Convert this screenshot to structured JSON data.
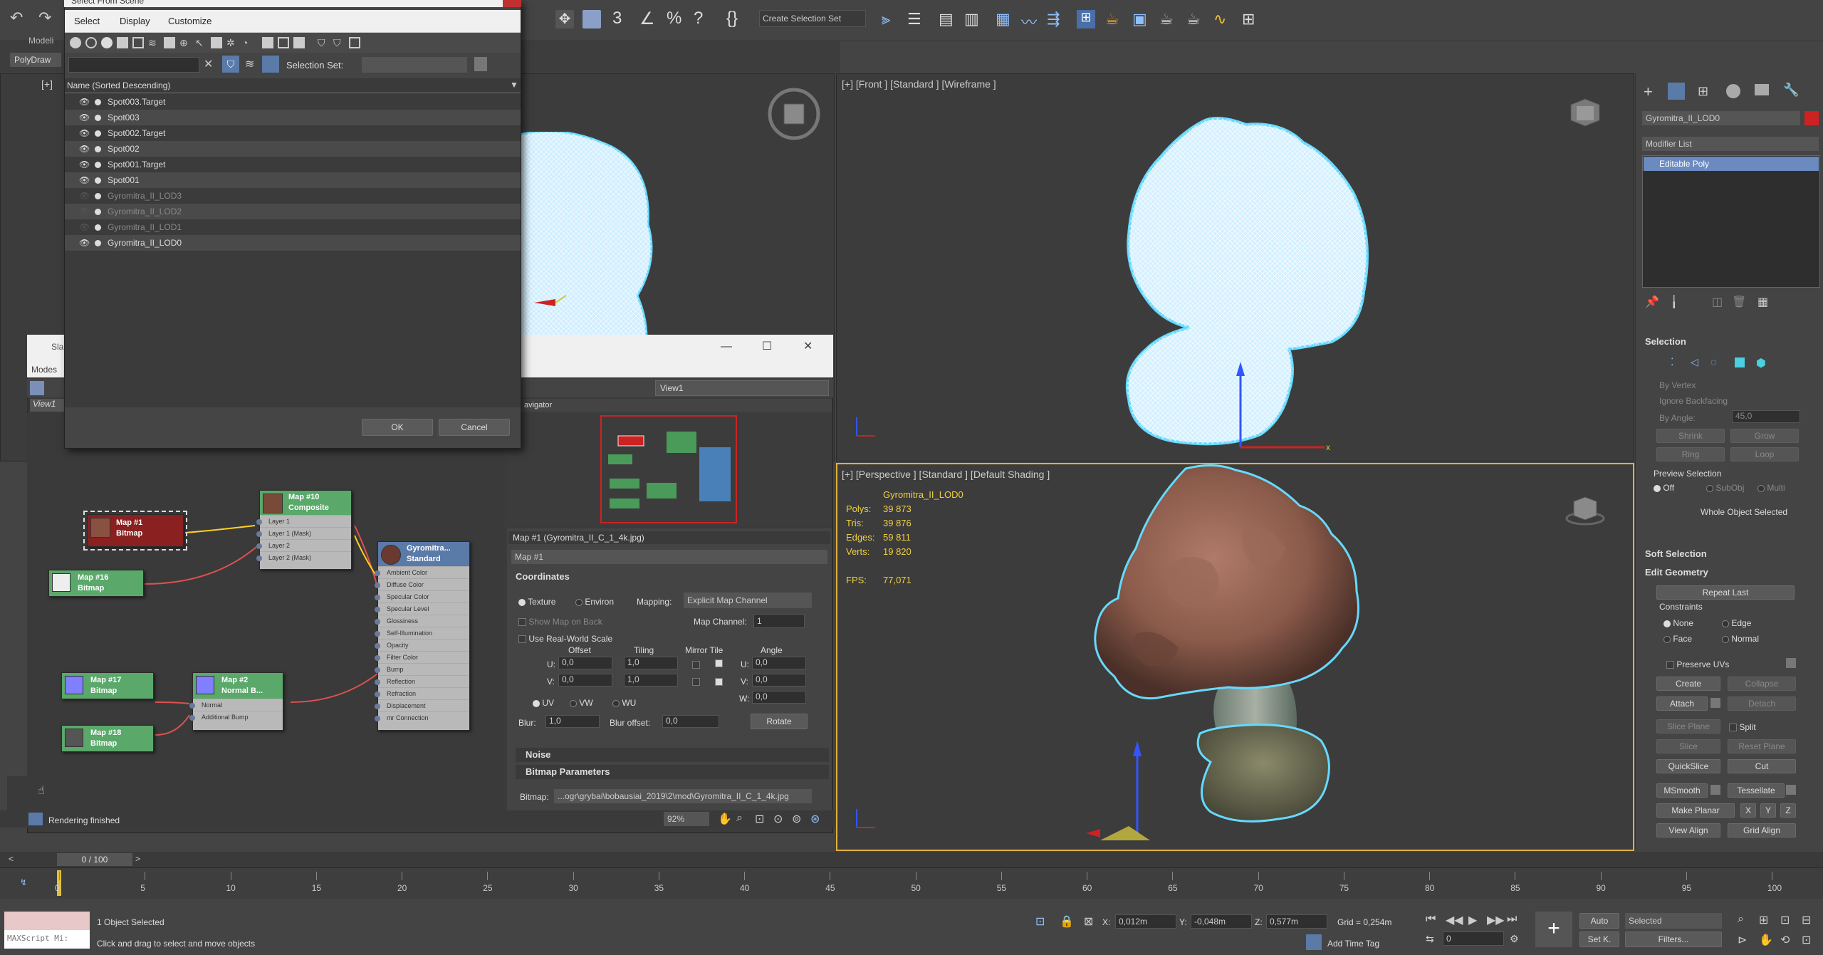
{
  "scene_dialog": {
    "title": "Select From Scene",
    "menu": [
      "Select",
      "Display",
      "Customize"
    ],
    "selection_set_label": "Selection Set:",
    "column_header": "Name (Sorted Descending)",
    "items": [
      {
        "name": "Spot003.Target",
        "dim": false,
        "eye": true
      },
      {
        "name": "Spot003",
        "dim": false,
        "eye": true
      },
      {
        "name": "Spot002.Target",
        "dim": false,
        "eye": true
      },
      {
        "name": "Spot002",
        "dim": false,
        "eye": true
      },
      {
        "name": "Spot001.Target",
        "dim": false,
        "eye": true
      },
      {
        "name": "Spot001",
        "dim": false,
        "eye": true
      },
      {
        "name": "Gyromitra_II_LOD3",
        "dim": true,
        "eye": false
      },
      {
        "name": "Gyromitra_II_LOD2",
        "dim": true,
        "eye": false
      },
      {
        "name": "Gyromitra_II_LOD1",
        "dim": true,
        "eye": false
      },
      {
        "name": "Gyromitra_II_LOD0",
        "dim": false,
        "eye": true
      }
    ],
    "ok": "OK",
    "cancel": "Cancel"
  },
  "left_strip": {
    "modeling": "Modeli",
    "polydraw": "PolyDraw",
    "slate": "Sla",
    "modes": "Modes",
    "view1": "View1"
  },
  "toolbar": {
    "create_selection_set": "Create Selection Set"
  },
  "viewports": {
    "top_left_label": "[+]",
    "front_label": "[+] [Front ] [Standard ] [Wireframe ]",
    "persp_label": "[+] [Perspective ] [Standard ] [Default Shading ]",
    "stats": {
      "object": "Gyromitra_II_LOD0",
      "rows": [
        {
          "k": "Polys:",
          "v": "39 873"
        },
        {
          "k": "Tris:",
          "v": "39 876"
        },
        {
          "k": "Edges:",
          "v": "59 811"
        },
        {
          "k": "Verts:",
          "v": "19 820"
        }
      ],
      "fps_k": "FPS:",
      "fps_v": "77,071"
    }
  },
  "slate": {
    "view_tab": "View1",
    "navigator": "avigator",
    "rendering_finished": "Rendering finished",
    "zoom": "92%",
    "nodes": {
      "map1": {
        "title": "Map #1",
        "sub": "Bitmap"
      },
      "map16": {
        "title": "Map #16",
        "sub": "Bitmap"
      },
      "map10": {
        "title": "Map #10",
        "sub": "Composite",
        "slots": [
          "Layer 1",
          "Layer 1 (Mask)",
          "Layer 2",
          "Layer 2 (Mask)"
        ]
      },
      "gyro": {
        "title": "Gyromitra...",
        "sub": "Standard",
        "slots": [
          "Ambient Color",
          "Diffuse Color",
          "Specular Color",
          "Specular Level",
          "Glossiness",
          "Self-Illumination",
          "Opacity",
          "Filter Color",
          "Bump",
          "Reflection",
          "Refraction",
          "Displacement",
          "mr Connection"
        ]
      },
      "map17": {
        "title": "Map #17",
        "sub": "Bitmap"
      },
      "map2": {
        "title": "Map #2",
        "sub": "Normal B...",
        "slots": [
          "Normal",
          "Additional Bump"
        ]
      },
      "map18": {
        "title": "Map #18",
        "sub": "Bitmap"
      }
    }
  },
  "params": {
    "header": "Map #1 (Gyromitra_II_C_1_4k.jpg)",
    "name_field": "Map #1",
    "coordinates": "Coordinates",
    "texture": "Texture",
    "environ": "Environ",
    "mapping_label": "Mapping:",
    "mapping_value": "Explicit Map Channel",
    "show_map_on_back": "Show Map on Back",
    "map_channel_label": "Map Channel:",
    "map_channel": "1",
    "use_real_world": "Use Real-World Scale",
    "col_offset": "Offset",
    "col_tiling": "Tiling",
    "col_mirror_tile": "Mirror Tile",
    "col_angle": "Angle",
    "u_label": "U:",
    "v_label": "V:",
    "w_label": "W:",
    "u_offset": "0,0",
    "v_offset": "0,0",
    "u_tiling": "1,0",
    "v_tiling": "1,0",
    "u_angle": "0,0",
    "v_angle": "0,0",
    "w_angle": "0,0",
    "uv": "UV",
    "vw": "VW",
    "wu": "WU",
    "blur_label": "Blur:",
    "blur": "1,0",
    "blur_offset_label": "Blur offset:",
    "blur_offset": "0,0",
    "rotate": "Rotate",
    "noise": "Noise",
    "bitmap_params": "Bitmap Parameters",
    "bitmap_label": "Bitmap:",
    "bitmap_path": "...ogr\\grybai\\bobausiai_2019\\2\\mod\\Gyromitra_II_C_1_4k.jpg"
  },
  "command_panel": {
    "object_name": "Gyromitra_II_LOD0",
    "object_color": "#cc2222",
    "modifier_list": "Modifier List",
    "stack_item": "Editable Poly",
    "selection": "Selection",
    "by_vertex": "By Vertex",
    "ignore_backfacing": "Ignore Backfacing",
    "by_angle": "By Angle:",
    "by_angle_value": "45,0",
    "shrink": "Shrink",
    "grow": "Grow",
    "ring": "Ring",
    "loop": "Loop",
    "preview_selection": "Preview Selection",
    "off": "Off",
    "subobj": "SubObj",
    "multi": "Multi",
    "whole_object_selected": "Whole Object Selected",
    "soft_selection": "Soft Selection",
    "edit_geometry": "Edit Geometry",
    "repeat_last": "Repeat Last",
    "constraints": "Constraints",
    "none": "None",
    "edge": "Edge",
    "face": "Face",
    "normal": "Normal",
    "preserve_uvs": "Preserve UVs",
    "create": "Create",
    "collapse": "Collapse",
    "attach": "Attach",
    "detach": "Detach",
    "slice_plane": "Slice Plane",
    "split": "Split",
    "slice": "Slice",
    "reset_plane": "Reset Plane",
    "quickslice": "QuickSlice",
    "cut": "Cut",
    "msmooth": "MSmooth",
    "tessellate": "Tessellate",
    "make_planar": "Make Planar",
    "x": "X",
    "y": "Y",
    "z": "Z",
    "view_align": "View Align",
    "grid_align": "Grid Align"
  },
  "timeline": {
    "frame": "0 / 100",
    "ticks": [
      "0",
      "5",
      "10",
      "15",
      "20",
      "25",
      "30",
      "35",
      "40",
      "45",
      "50",
      "55",
      "60",
      "65",
      "70",
      "75",
      "80",
      "85",
      "90",
      "95",
      "100"
    ]
  },
  "status": {
    "maxscript": "MAXScript Mi:",
    "selected": "1 Object Selected",
    "hint": "Click and drag to select and move objects",
    "x_label": "X:",
    "x": "0,012m",
    "y_label": "Y:",
    "y": "-0,048m",
    "z_label": "Z:",
    "z": "0,577m",
    "grid": "Grid = 0,254m",
    "add_time_tag": "Add Time Tag",
    "auto": "Auto",
    "set_k": "Set K.",
    "selected_dd": "Selected",
    "filters": "Filters...",
    "frame_field": "0"
  }
}
